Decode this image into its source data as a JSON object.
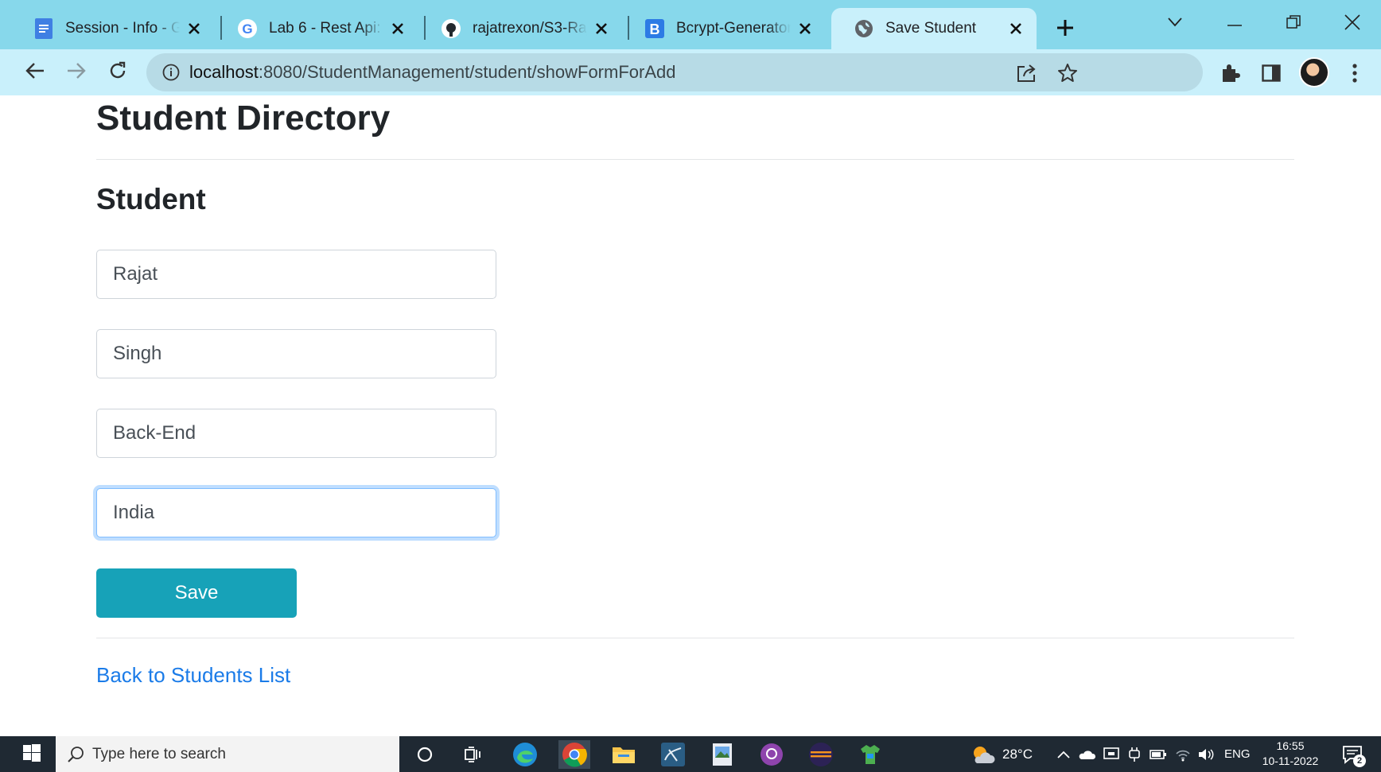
{
  "browser": {
    "tabs": [
      {
        "title": "Session - Info - Google Docs",
        "favicon": "docs-icon"
      },
      {
        "title": "Lab 6 - Rest Api: Exercise",
        "favicon": "google-icon"
      },
      {
        "title": "rajatrexon/S3-Rajat",
        "favicon": "github-icon"
      },
      {
        "title": "Bcrypt-Generator.com",
        "favicon": "bcrypt-icon"
      },
      {
        "title": "Save Student",
        "favicon": "globe-icon"
      }
    ],
    "url_host": "localhost",
    "url_path": ":8080/StudentManagement/student/showFormForAdd"
  },
  "page": {
    "title": "Student Directory",
    "subtitle": "Student",
    "form": {
      "first_name": "Rajat",
      "last_name": "Singh",
      "department": "Back-End",
      "country": "India",
      "save_label": "Save"
    },
    "back_link": "Back to Students List"
  },
  "taskbar": {
    "search_placeholder": "Type here to search",
    "weather": "28°C",
    "language": "ENG",
    "time": "16:55",
    "date": "10-11-2022",
    "notifications": "2"
  },
  "colors": {
    "tabstrip": "#87d8eb",
    "toolbar": "#c9f0fb",
    "save_button": "#17a2b8",
    "link": "#1a7be8"
  }
}
